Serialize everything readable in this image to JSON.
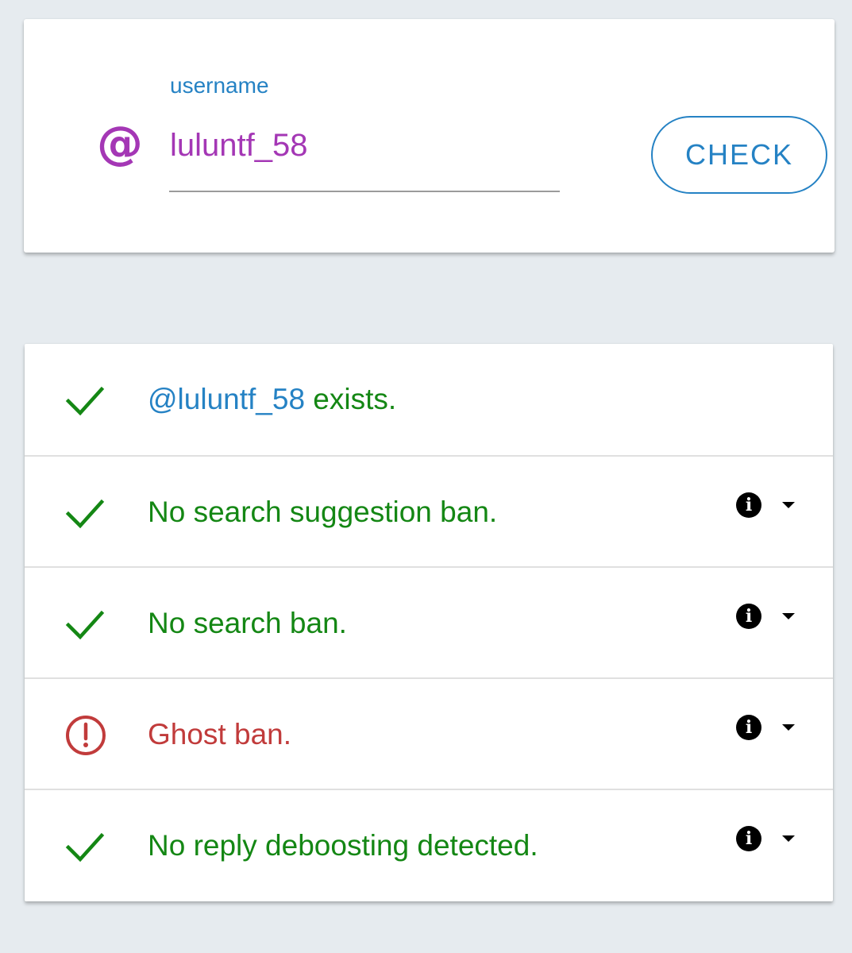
{
  "search": {
    "at_symbol": "@",
    "label": "username",
    "value": "luluntf_58",
    "button_label": "CHECK"
  },
  "results": [
    {
      "status": "ok",
      "icon": "check-icon",
      "handle": "@luluntf_58",
      "text": " exists.",
      "has_details": false
    },
    {
      "status": "ok",
      "icon": "check-icon",
      "text": "No search suggestion ban.",
      "has_details": true
    },
    {
      "status": "ok",
      "icon": "check-icon",
      "text": "No search ban.",
      "has_details": true
    },
    {
      "status": "ban",
      "icon": "alert-circle-icon",
      "text": "Ghost ban.",
      "has_details": true
    },
    {
      "status": "ok",
      "icon": "check-icon",
      "text": "No reply deboosting detected.",
      "has_details": true
    }
  ],
  "info_glyph": "i",
  "colors": {
    "background": "#e6ebef",
    "accent": "#2582c4",
    "username": "#a437b5",
    "ok": "#148714",
    "ban": "#c13b3b"
  }
}
